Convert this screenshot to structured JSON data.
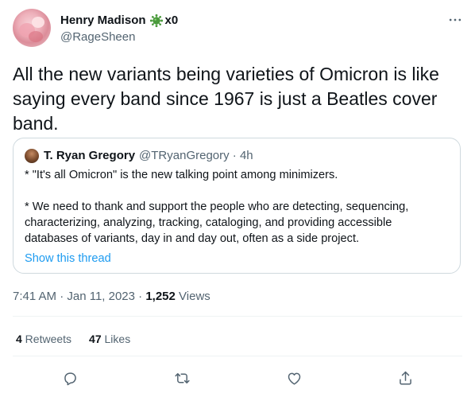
{
  "author": {
    "name": "Henry Madison",
    "suffix": "x0",
    "handle": "@RageSheen"
  },
  "tweet": {
    "text": "All the new variants being varieties of Omicron is like saying every band since 1967 is just a Beatles cover band."
  },
  "quote": {
    "name": "T. Ryan Gregory",
    "handle": "@TRyanGregory · 4h",
    "paragraph1": "* \"It's all Omicron\" is the new talking point among minimizers.",
    "paragraph2": "* We need to thank and support the people who are detecting, sequencing, characterizing, analyzing, tracking, cataloging, and providing accessible databases of variants, day in and day out, often as a side project.",
    "show_thread": "Show this thread"
  },
  "meta": {
    "time": "7:41 AM · Jan 11, 2023 · ",
    "views_count": "1,252",
    "views_label": " Views"
  },
  "stats": {
    "retweets_count": "4",
    "retweets_label": " Retweets",
    "likes_count": "47",
    "likes_label": " Likes"
  },
  "icons": {
    "more": "more-dots-icon",
    "reply": "reply-icon",
    "retweet": "retweet-icon",
    "like": "heart-icon",
    "share": "share-icon",
    "badge": "virus-icon"
  },
  "colors": {
    "link": "#1d9bf0",
    "secondary_text": "#536471",
    "border": "#cfd9de"
  }
}
